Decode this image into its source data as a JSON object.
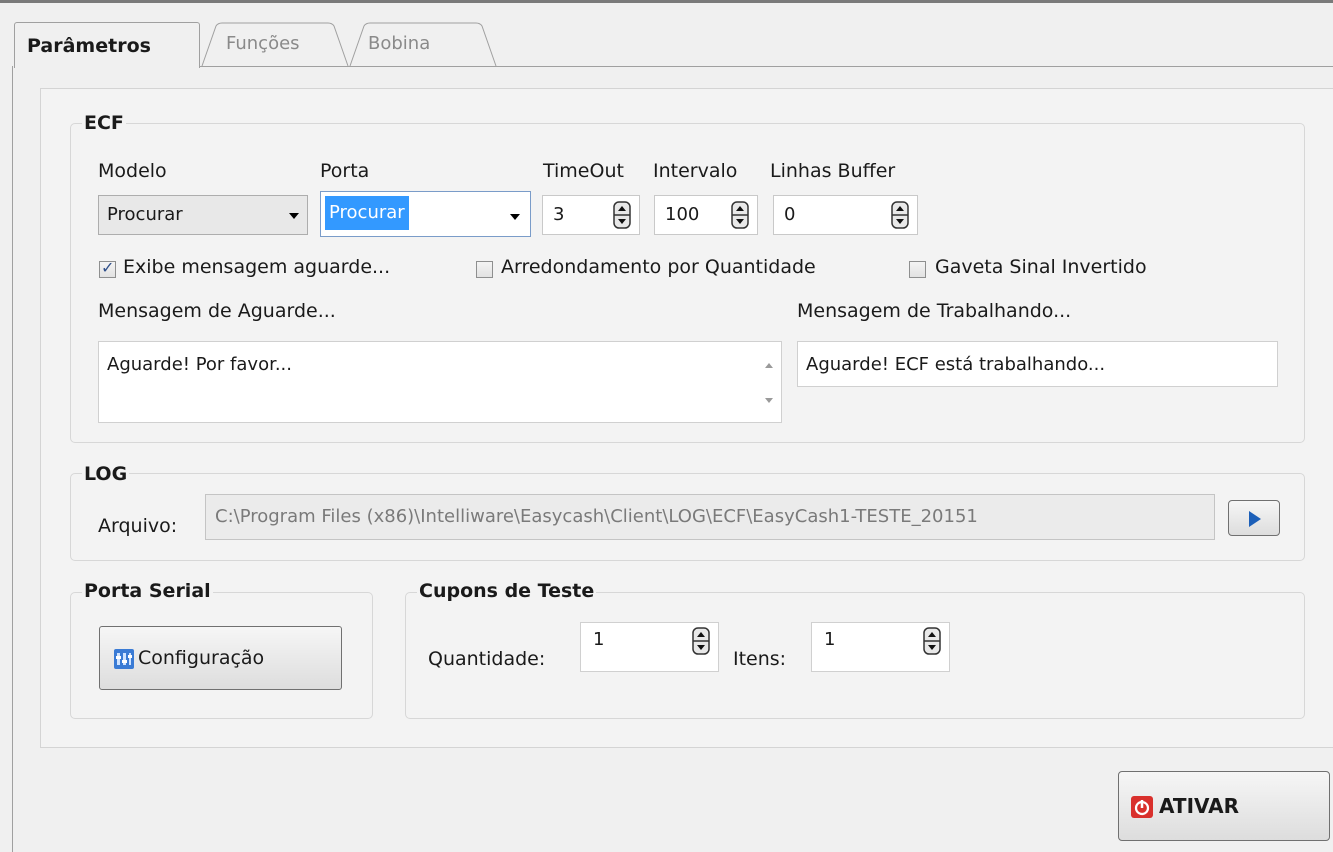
{
  "tabs": [
    {
      "label": "Parâmetros",
      "active": true
    },
    {
      "label": "Funções",
      "active": false
    },
    {
      "label": "Bobina",
      "active": false
    }
  ],
  "ecf": {
    "title": "ECF",
    "modelo_label": "Modelo",
    "modelo_value": "Procurar",
    "porta_label": "Porta",
    "porta_value": "Procurar",
    "timeout_label": "TimeOut",
    "timeout_value": "3",
    "intervalo_label": "Intervalo",
    "intervalo_value": "100",
    "linhas_buffer_label": "Linhas Buffer",
    "linhas_buffer_value": "0",
    "checkboxes": [
      {
        "label": "Exibe mensagem aguarde...",
        "checked": true
      },
      {
        "label": "Arredondamento por Quantidade",
        "checked": false
      },
      {
        "label": "Gaveta Sinal Invertido",
        "checked": false
      }
    ],
    "msg_aguarde_label": "Mensagem de Aguarde...",
    "msg_aguarde_value": "Aguarde! Por favor...",
    "msg_trabalhando_label": "Mensagem de Trabalhando...",
    "msg_trabalhando_value": "Aguarde! ECF está trabalhando..."
  },
  "log": {
    "title": "LOG",
    "arquivo_label": "Arquivo:",
    "arquivo_value": "C:\\Program Files (x86)\\Intelliware\\Easycash\\Client\\LOG\\ECF\\EasyCash1-TESTE_20151"
  },
  "porta_serial": {
    "title": "Porta Serial",
    "button_label": "Configuração"
  },
  "cupons": {
    "title": "Cupons de Teste",
    "quantidade_label": "Quantidade:",
    "quantidade_value": "1",
    "itens_label": "Itens:",
    "itens_value": "1"
  },
  "ativar_label": "ATIVAR",
  "colors": {
    "selection": "#3399ff",
    "ativar_icon": "#d9302c",
    "config_icon": "#3a7bd5"
  }
}
